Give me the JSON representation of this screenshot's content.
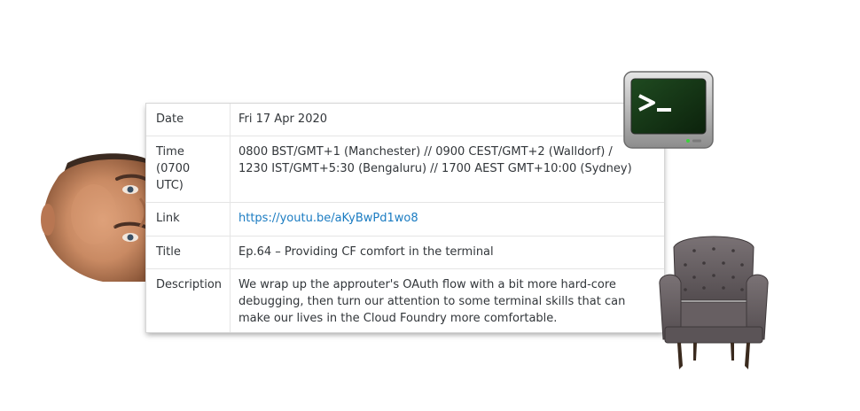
{
  "table": {
    "rows": [
      {
        "key": "Date",
        "value": "Fri 17 Apr 2020"
      },
      {
        "key": "Time\n(0700\nUTC)",
        "value_line1": "0800 BST/GMT+1 (Manchester) // 0900 CEST/GMT+2 (Walldorf) /",
        "value_line2": "1230 IST/GMT+5:30 (Bengaluru) // 1700 AEST GMT+10:00 (Sydney)"
      },
      {
        "key": "Link",
        "value": "https://youtu.be/aKyBwPd1wo8"
      },
      {
        "key": "Title",
        "value": "Ep.64 – Providing CF comfort in the terminal"
      },
      {
        "key": "Description",
        "value": "We wrap up the approuter's OAuth flow with a bit more hard-core debugging, then turn our attention to some terminal skills that can make our lives in the Cloud Foundry more comfortable."
      }
    ],
    "time_key_lines": [
      "Time",
      "(0700",
      "UTC)"
    ]
  },
  "colors": {
    "link": "#1b7cc2",
    "text": "#32363a",
    "border": "#e5e5e5",
    "terminal_screen": "#143514",
    "terminal_prompt": "#ffffff",
    "chair_fabric": "#6b6366"
  },
  "icons": {
    "terminal": "terminal-icon",
    "chair": "armchair-image",
    "face": "face-image"
  }
}
